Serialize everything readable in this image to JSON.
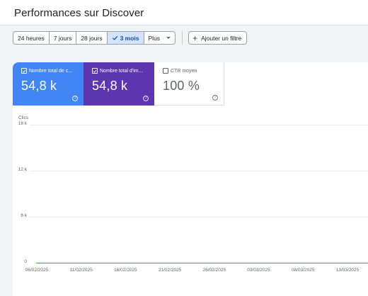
{
  "page": {
    "title": "Performances sur Discover"
  },
  "filters": {
    "ranges": [
      {
        "label": "24 heures",
        "selected": false
      },
      {
        "label": "7 jours",
        "selected": false
      },
      {
        "label": "28 jours",
        "selected": false
      },
      {
        "label": "3 mois",
        "selected": true
      },
      {
        "label": "Plus",
        "selected": false,
        "dropdown": true
      }
    ],
    "add_filter_label": "Ajouter un filtre"
  },
  "metrics": [
    {
      "label": "Nombre total de c...",
      "value": "54,8 k",
      "checked": true,
      "color": "#4285f4"
    },
    {
      "label": "Nombre total d'im...",
      "value": "54,8 k",
      "checked": true,
      "color": "#5e35b1"
    },
    {
      "label": "CTR moyen",
      "value": "100 %",
      "checked": false,
      "color": "#ffffff"
    }
  ],
  "chart_data": {
    "type": "line",
    "ylabel": "Clics",
    "ylim": [
      0,
      18000
    ],
    "y_ticks": [
      "0",
      "6 k",
      "12 k",
      "18 k"
    ],
    "x_ticks": [
      "06/02/2025",
      "11/02/2025",
      "16/02/2025",
      "21/02/2025",
      "26/02/2025",
      "03/03/2025",
      "08/03/2025",
      "13/03/2025"
    ],
    "series": [
      {
        "color": "#4285f4",
        "values": [
          0,
          0,
          0,
          0,
          0,
          0,
          0,
          0
        ]
      }
    ],
    "grid": true
  }
}
